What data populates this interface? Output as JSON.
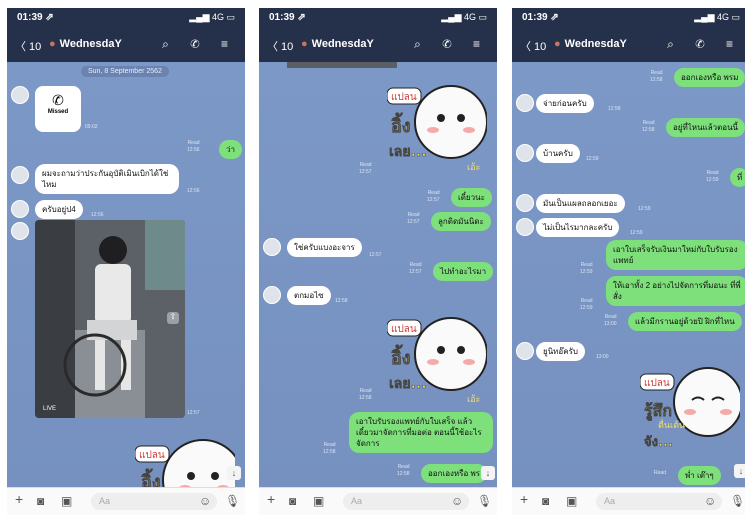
{
  "statusbar": {
    "time": "01:39 ⇗",
    "signal": "▂▄▆ 4G ▭"
  },
  "header": {
    "back": "〈 10",
    "chat_name": "WednesdaY",
    "icons": "⌕ ✆ ≡"
  },
  "inputbar": {
    "placeholder": "Aa"
  },
  "p1": {
    "date": "Sun, 8 September 2562",
    "missed": "Missed",
    "missed_time": "09:02",
    "m1": "ว่า",
    "m1_meta": "Read\n12:56",
    "m2": "ผมจะถามว่าประกันอุบัติเมินเบิกได้ใช่ไหม",
    "m2_time": "12:56",
    "m3": "ครับอยู่ป4",
    "m3_time": "12:56",
    "live": "LIVE",
    "photo_time": "12:57",
    "sticker_text1": "แปลน",
    "sticker_text2": "อิ้ง"
  },
  "p2": {
    "sticker_meta": "Read\n12:57",
    "s1_text1": "แปลน",
    "s1_text2": "อิ้ง",
    "s1_text3": "เลย...",
    "s1_text4": "เอ้ะ",
    "m1": "เดี๋ยวนะ",
    "m1_meta": "Read\n12:57",
    "m2": "ลูกติดมันนิดะ",
    "m2_meta": "Read\n12:57",
    "m3": "ใช่ครับแบงอะจาร",
    "m3_time": "12:57",
    "m4": "ไปทำอะไรมา",
    "m4_meta": "Read\n12:57",
    "m5": "ตกมอไซ",
    "m5_time": "12:58",
    "s2_meta": "Read\n12:58",
    "s2_text1": "แปลน",
    "s2_text2": "อิ้ง",
    "s2_text3": "เลย...",
    "s2_text4": "เอ้ะ",
    "m6": "เอาใบรับรองแพทย์กับใบเสร็จ แล้วเดี๋ยวมาจัดการที่มอต่อ ตอนนี้ใช้อะไรจัดการ",
    "m6_meta": "Read\n12:58",
    "m7": "ออกเองหรือ พร",
    "m7_meta": "Read\n12:58"
  },
  "p3": {
    "m1": "ออกเองหรือ พรม",
    "m1_meta": "Read\n12:58",
    "m2": "จ่ายก่อนครับ",
    "m2_time": "12:58",
    "m3": "อยู่ที่ไหนแล้วตอนนี้",
    "m3_meta": "Read\n12:58",
    "m4": "บ้านครับ",
    "m4_time": "12:59",
    "m5": "ที่",
    "m5_meta": "Read\n12:59",
    "m6": "มันเป็นแผลถลอกเยอะ",
    "m6_time": "12:59",
    "m7": "ไม่เป็นไรมากละครับ",
    "m7_time": "12:59",
    "m8": "เอาใบเสร็จรับเงินมาใหม่กับใบรับรองแพทย์",
    "m8_meta": "Read\n12:59",
    "m9": "ให้เอาทั้ง 2 อย่างไปจัดการที่มอนะ ที่พี่สั่ง",
    "m9_meta": "Read\n12:59",
    "m10": "แล้วมีกรานอยู่ด้วยปิ ฝิกที่ไหน",
    "m10_meta": "Read\n13:00",
    "m11": "ยูนิทอ๊ครับ",
    "m11_time": "13:00",
    "s_text1": "แปลน",
    "s_text2": "รู้สึก",
    "s_text3": "ตื่นเต้น",
    "s_text4": "จัง...",
    "m12": "พ่ำ เต๊าๆ",
    "m12_meta": "Read"
  },
  "colors": {
    "header": "#25304a",
    "chat_bg": "#7b96c4",
    "bubble_out": "#7ee07a",
    "bubble_in": "#ffffff"
  }
}
